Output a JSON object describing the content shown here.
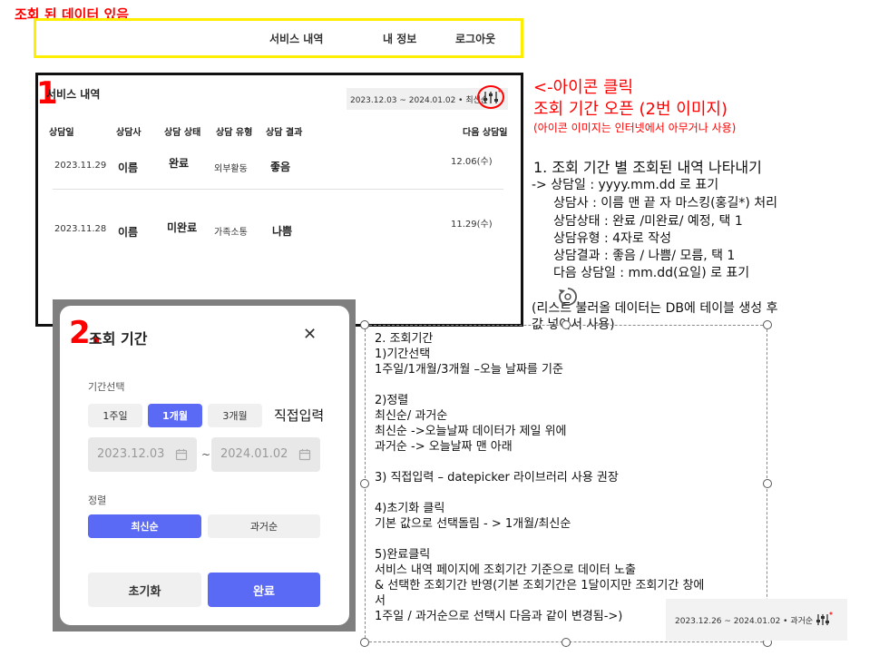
{
  "page": {
    "top_title": "조회 된 데이터 있음",
    "nav": [
      "서비스 내역",
      "내 정보",
      "로그아웃"
    ]
  },
  "panel1": {
    "number": "1",
    "title": "서비스 내역",
    "filter_text": "2023.12.03 ~ 2024.01.02 • 최신순",
    "columns": [
      "상담일",
      "상담사",
      "상담 상태",
      "상담 유형",
      "상담 결과",
      "다음 상담일"
    ],
    "rows": [
      {
        "date": "2023.11.29",
        "counselor": "이름",
        "status": "완료",
        "type": "외부활동",
        "result": "좋음",
        "next": "12.06(수)"
      },
      {
        "date": "2023.11.28",
        "counselor": "이름",
        "status": "미완료",
        "type": "가족소통",
        "result": "나쁨",
        "next": "11.29(수)"
      }
    ]
  },
  "annotation_icon": {
    "line1": "<-아이콘 클릭",
    "line2": "조회 기간 오픈 (2번 이미지)",
    "line3": "(아이콘 이미지는 인터넷에서 아무거나 사용)"
  },
  "annotation_list": {
    "heading": "1.    조회 기간 별 조회된 내역 나타내기",
    "lines": [
      "-> 상담일 : yyyy.mm.dd 로 표기",
      "상담사 : 이름 맨 끝 자 마스킹(홍길*) 처리",
      "상담상태 : 완료 /미완료/ 예정, 택 1",
      "상담유형 : 4자로 작성",
      "상담결과 : 좋음 / 나쁨/ 모름, 택 1",
      "다음 상담일 : mm.dd(요일) 로 표기"
    ],
    "note1": "(리스트 불러올 데이터는 DB에 테이블 생성 후",
    "note2": "값 넣어서 사용)"
  },
  "modal": {
    "number": "2.",
    "title": "조회 기간",
    "close_glyph": "✕",
    "period_label": "기간선택",
    "periods": [
      "1주일",
      "1개월",
      "3개월"
    ],
    "direct_input": "직접입력",
    "date_from": "2023.12.03",
    "date_sep": "~",
    "date_to": "2024.01.02",
    "sort_label": "정렬",
    "sorts": [
      "최신순",
      "과거순"
    ],
    "reset": "초기화",
    "done": "완료"
  },
  "notes": {
    "lines": [
      "2. 조회기간",
      "1)기간선택",
      "1주일/1개월/3개월 –오늘 날짜를 기준",
      "",
      "2)정렬",
      "최신순/ 과거순",
      "최신순 ->오늘날짜 데이터가 제일 위에",
      "과거순 -> 오늘날짜 맨 아래",
      "",
      "3) 직접입력 – datepicker 라이브러리 사용 권장",
      "",
      "4)초기화 클릭",
      "기본 값으로 선택돌림 - > 1개월/최신순",
      "",
      "5)완료클릭",
      "서비스 내역 페이지에 조회기간 기준으로 데이터 노출",
      "& 선택한 조회기간 반영(기본 조회기간은 1달이지만 조회기간 창에",
      "서",
      "1주일 / 과거순으로 선택시 다음과 같이 변경됨->)"
    ],
    "bottom_filter_text": "2023.12.26 ~ 2024.01.02 • 과거순"
  },
  "colors": {
    "accent": "#5b6af5",
    "annotation_red": "#ff0000",
    "highlight_yellow": "#ffee00"
  }
}
